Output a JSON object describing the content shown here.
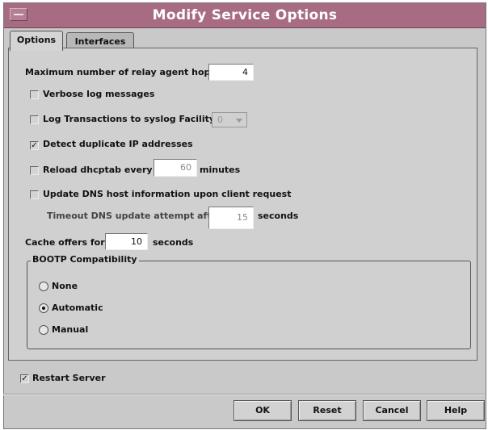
{
  "window": {
    "title": "Modify Service Options",
    "menu_icon": "window-menu-icon"
  },
  "tabs": [
    {
      "label": "Options",
      "active": true
    },
    {
      "label": "Interfaces",
      "active": false
    }
  ],
  "options": {
    "max_hops_label": "Maximum number of relay agent hops:",
    "max_hops_value": "4",
    "verbose_label": "Verbose log messages",
    "verbose_checked": false,
    "log_transactions_label": "Log Transactions to syslog Facility:",
    "log_transactions_checked": false,
    "syslog_facility_value": "0",
    "detect_duplicate_label": "Detect duplicate IP addresses",
    "detect_duplicate_checked": true,
    "detect_duplicate_mark": "✓",
    "reload_label": "Reload dhcptab every",
    "reload_checked": false,
    "reload_value": "60",
    "reload_units": "minutes",
    "update_dns_label": "Update DNS host information upon client request",
    "update_dns_checked": false,
    "timeout_label": "Timeout DNS update attempt after",
    "timeout_value": "15",
    "timeout_units": "seconds",
    "cache_label": "Cache offers for",
    "cache_value": "10",
    "cache_units": "seconds"
  },
  "bootp": {
    "title": "BOOTP Compatibility",
    "options": [
      {
        "label": "None",
        "selected": false
      },
      {
        "label": "Automatic",
        "selected": true
      },
      {
        "label": "Manual",
        "selected": false
      }
    ]
  },
  "restart": {
    "label": "Restart Server",
    "checked": true,
    "mark": "✓"
  },
  "buttons": {
    "ok": "OK",
    "reset": "Reset",
    "cancel": "Cancel",
    "help": "Help"
  }
}
